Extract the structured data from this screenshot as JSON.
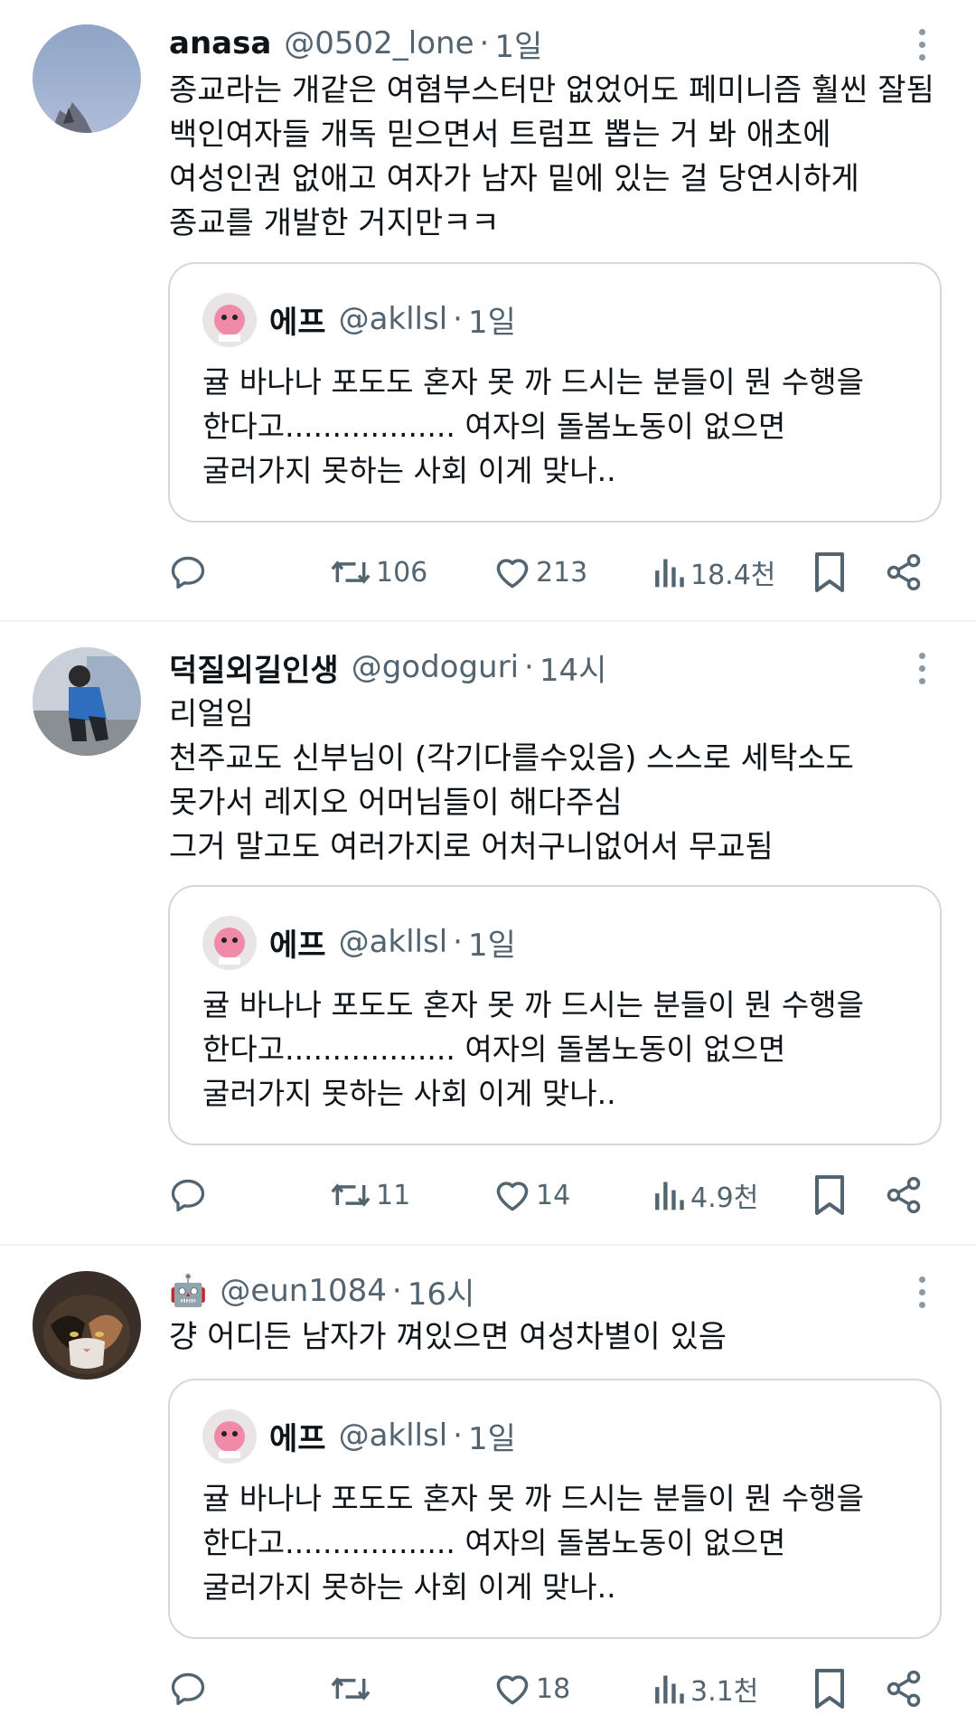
{
  "tweets": [
    {
      "name": "anasa",
      "handle": "@0502_lone",
      "time": "1일",
      "lines": [
        "종교라는 개같은 여혐부스터만 없었어도 페미니즘 훨씬 잘됨",
        "백인여자들 개독 믿으면서 트럼프 뽑는 거 봐 애초에",
        "여성인권 없애고 여자가 남자 밑에 있는 걸 당연시하게",
        "종교를 개발한 거지만ㅋㅋ"
      ],
      "quote": {
        "name": "에프",
        "handle": "@akllsl",
        "time": "1일",
        "lines": [
          "귤 바나나 포도도 혼자 못 까 드시는 분들이 뭔 수행을",
          "한다고.................. 여자의 돌봄노동이 없으면",
          "굴러가지 못하는 사회 이게 맞나.."
        ]
      },
      "retweets": "106",
      "likes": "213",
      "views": "18.4천"
    },
    {
      "name": "덕질외길인생",
      "handle": "@godoguri",
      "time": "14시",
      "lines": [
        "리얼임",
        "천주교도 신부님이 (각기다를수있음) 스스로 세탁소도",
        "못가서 레지오 어머님들이 해다주심",
        "그거 말고도 여러가지로 어처구니없어서 무교됨"
      ],
      "quote": {
        "name": "에프",
        "handle": "@akllsl",
        "time": "1일",
        "lines": [
          "귤 바나나 포도도 혼자 못 까 드시는 분들이 뭔 수행을",
          "한다고.................. 여자의 돌봄노동이 없으면",
          "굴러가지 못하는 사회 이게 맞나.."
        ]
      },
      "retweets": "11",
      "likes": "14",
      "views": "4.9천"
    },
    {
      "name": "🤖",
      "handle": "@eun1084",
      "time": "16시",
      "lines": [
        "걍 어디든 남자가 껴있으면 여성차별이 있음"
      ],
      "quote": {
        "name": "에프",
        "handle": "@akllsl",
        "time": "1일",
        "lines": [
          "귤 바나나 포도도 혼자 못 까 드시는 분들이 뭔 수행을",
          "한다고.................. 여자의 돌봄노동이 없으면",
          "굴러가지 못하는 사회 이게 맞나.."
        ]
      },
      "retweets": "",
      "likes": "18",
      "views": "3.1천"
    }
  ],
  "icons": {
    "reply": "reply-icon",
    "retweet": "retweet-icon",
    "like": "heart-icon",
    "views": "views-icon",
    "bookmark": "bookmark-icon",
    "share": "share-icon",
    "more": "more-icon"
  },
  "colors": {
    "text": "#0f1419",
    "secondary": "#536471",
    "border": "#cfd9de",
    "divider": "#eff3f4"
  }
}
